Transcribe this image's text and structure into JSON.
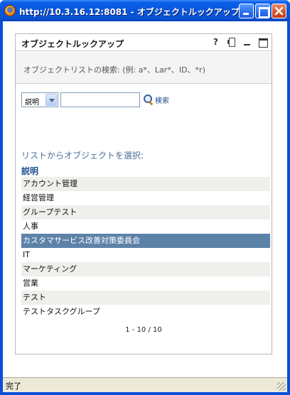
{
  "window": {
    "title": "http://10.3.16.12:8081 - オブジェクトルックアップ..."
  },
  "portlet": {
    "title": "オブジェクトルックアップ",
    "help_icon": "?"
  },
  "search": {
    "hint": "オブジェクトリストの検索: (例: a*、Lar*、ID、*r)",
    "field_selected": "説明",
    "input_value": "",
    "button_label": "検索"
  },
  "list": {
    "heading": "リストからオブジェクトを選択:",
    "column_header": "説明",
    "items": [
      "アカウント管理",
      "経営管理",
      "グループテスト",
      "人事",
      "カスタマサービス改善対策委員会",
      "IT",
      "マーケティング",
      "営業",
      "テスト",
      "テストタスクグループ"
    ],
    "selected_index": 4
  },
  "pager": {
    "text": "1 - 10 / 10"
  },
  "statusbar": {
    "text": "完了"
  },
  "colors": {
    "selected_row": "#5d82a8",
    "link": "#1f4e8c",
    "titlebar": "#0a5fe8"
  },
  "icons": [
    "firefox-icon",
    "minimize-icon",
    "maximize-icon",
    "close-icon",
    "help-icon",
    "print-icon",
    "portlet-minimize-icon",
    "portlet-maximize-icon",
    "magnifier-icon",
    "dropdown-arrow-icon"
  ]
}
